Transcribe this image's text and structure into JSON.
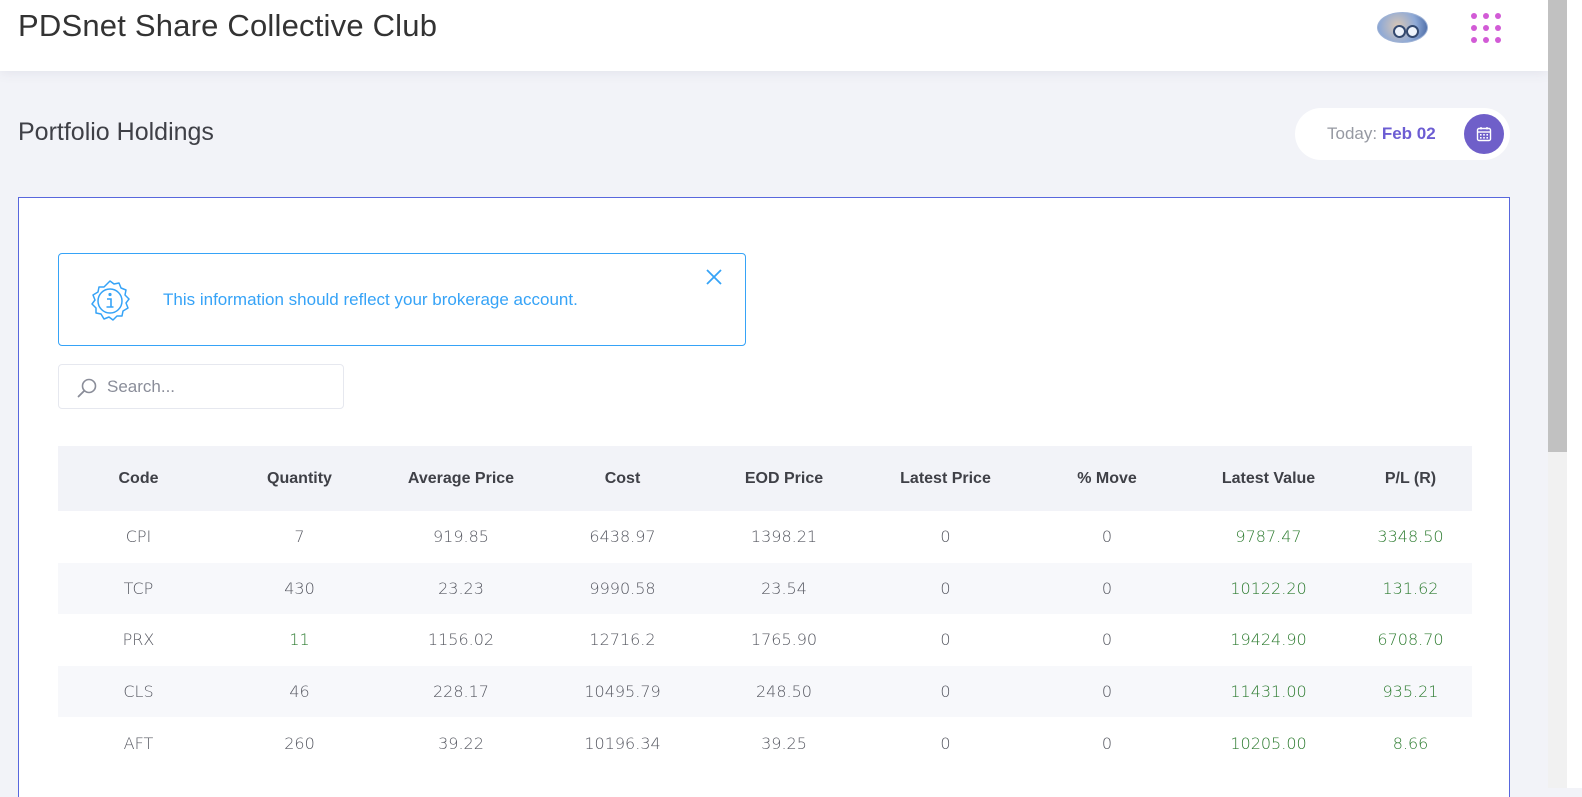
{
  "header": {
    "app_title": "PDSnet Share Collective Club",
    "avatar_icon": "user-avatar",
    "apps_icon": "apps-grid-icon",
    "accent_color": "#d25bd6"
  },
  "page": {
    "title": "Portfolio Holdings",
    "today_label": "Today:",
    "today_value": "Feb 02",
    "calendar_icon": "calendar-icon"
  },
  "alert": {
    "icon": "info-icon",
    "message": "This information should reflect your brokerage account.",
    "close_icon": "close-icon",
    "color": "#36a3f7"
  },
  "search": {
    "placeholder": "Search...",
    "value": ""
  },
  "table": {
    "columns": [
      "Code",
      "Quantity",
      "Average Price",
      "Cost",
      "EOD Price",
      "Latest Price",
      "% Move",
      "Latest Value",
      "P/L (R)"
    ],
    "rows": [
      {
        "code": "CPI",
        "quantity": "7",
        "average_price": "919.85",
        "cost": "6438.97",
        "eod_price": "1398.21",
        "latest_price": "0",
        "move": "0",
        "latest_value": "9787.47",
        "pl": "3348.50"
      },
      {
        "code": "TCP",
        "quantity": "430",
        "average_price": "23.23",
        "cost": "9990.58",
        "eod_price": "23.54",
        "latest_price": "0",
        "move": "0",
        "latest_value": "10122.20",
        "pl": "131.62"
      },
      {
        "code": "PRX",
        "quantity": "11",
        "average_price": "1156.02",
        "cost": "12716.2",
        "eod_price": "1765.90",
        "latest_price": "0",
        "move": "0",
        "latest_value": "19424.90",
        "pl": "6708.70"
      },
      {
        "code": "CLS",
        "quantity": "46",
        "average_price": "228.17",
        "cost": "10495.79",
        "eod_price": "248.50",
        "latest_price": "0",
        "move": "0",
        "latest_value": "11431.00",
        "pl": "935.21"
      },
      {
        "code": "AFT",
        "quantity": "260",
        "average_price": "39.22",
        "cost": "10196.34",
        "eod_price": "39.25",
        "latest_price": "0",
        "move": "0",
        "latest_value": "10205.00",
        "pl": "8.66"
      }
    ],
    "positive_color": "#2f7d32"
  }
}
